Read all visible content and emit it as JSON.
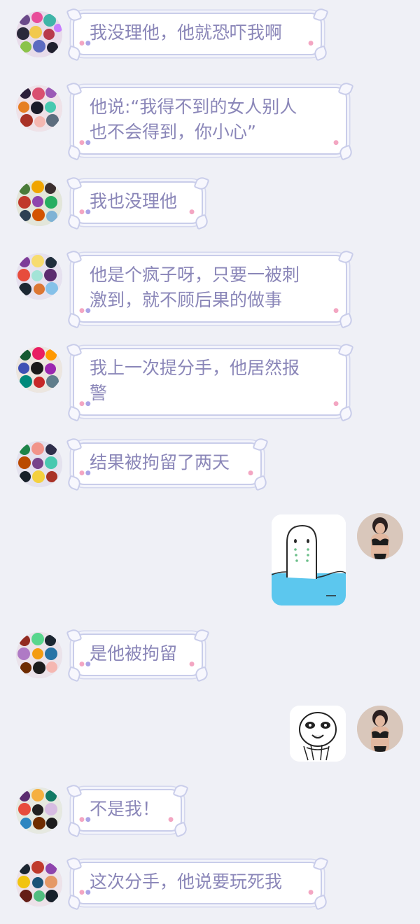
{
  "colors": {
    "background": "#eff0f6",
    "bubble_text": "#8a86b8",
    "bubble_border": "#c9cdea",
    "sticker_water": "#5cc7ee"
  },
  "messages": [
    {
      "side": "left",
      "type": "text",
      "text": "我没理他，他就恐吓我啊"
    },
    {
      "side": "left",
      "type": "text",
      "text": "他说:“我得不到的女人别人\n也不会得到，你小心”"
    },
    {
      "side": "left",
      "type": "text",
      "text": "我也没理他"
    },
    {
      "side": "left",
      "type": "text",
      "text": "他是个疯子呀，只要一被刺\n激到，就不顾后果的做事"
    },
    {
      "side": "left",
      "type": "text",
      "text": "我上一次提分手，他居然报\n警"
    },
    {
      "side": "left",
      "type": "text",
      "text": "结果被拘留了两天"
    },
    {
      "side": "right",
      "type": "sticker",
      "sticker": "crying-ghost-in-water"
    },
    {
      "side": "left",
      "type": "text",
      "text": "是他被拘留"
    },
    {
      "side": "right",
      "type": "sticker",
      "sticker": "shocked-face-meme"
    },
    {
      "side": "left",
      "type": "text",
      "text": "不是我！"
    },
    {
      "side": "left",
      "type": "text",
      "text": "这次分手，他说要玩死我"
    }
  ]
}
